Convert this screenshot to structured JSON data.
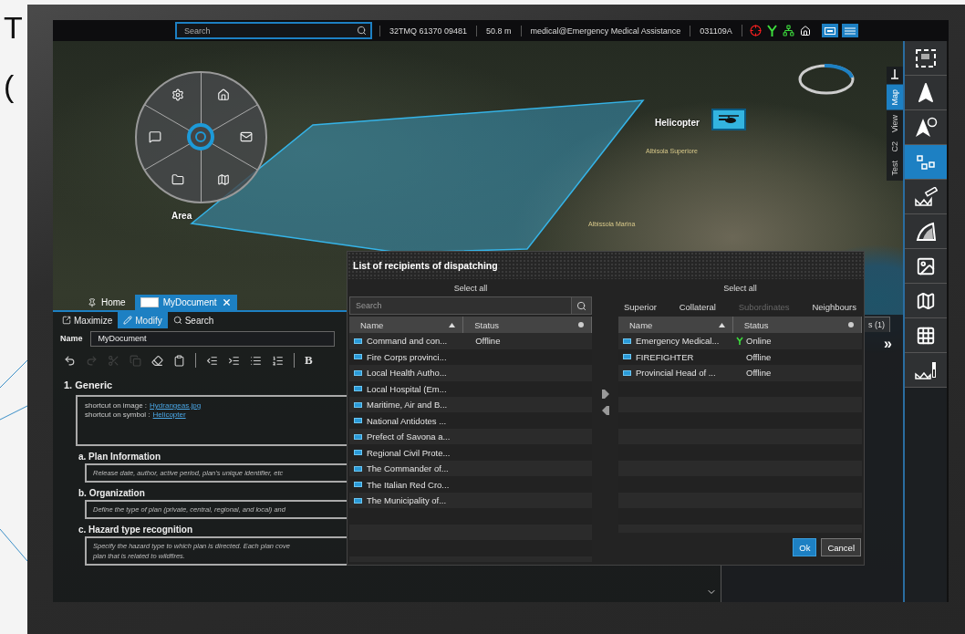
{
  "slide_fragments": [
    "T",
    "("
  ],
  "top_bar": {
    "search": {
      "placeholder": "Search"
    },
    "coordinates": "32TMQ 61370 09481",
    "altitude": "50.8 m",
    "user": "medical@Emergency Medical Assistance",
    "time": "031109A"
  },
  "map": {
    "labels": [
      {
        "text": "Area",
        "kind": "area"
      },
      {
        "text": "Helicopter",
        "kind": "unit"
      },
      {
        "text": "Albisola Superiore",
        "kind": "place"
      },
      {
        "text": "Albissola Marina",
        "kind": "place"
      }
    ]
  },
  "side_tabs": [
    {
      "label": "Map",
      "selected": true
    },
    {
      "label": "View",
      "selected": false
    },
    {
      "label": "C2",
      "selected": false
    },
    {
      "label": "Test",
      "selected": false
    }
  ],
  "toolbar": [
    {
      "kind": "select",
      "selected": false
    },
    {
      "kind": "navigate",
      "selected": false
    },
    {
      "kind": "navigate-compass",
      "selected": false
    },
    {
      "kind": "objects",
      "selected": true
    },
    {
      "kind": "measure",
      "selected": false
    },
    {
      "kind": "terrain",
      "selected": false
    },
    {
      "kind": "image",
      "selected": false
    },
    {
      "kind": "map",
      "selected": false
    },
    {
      "kind": "grid",
      "selected": false
    },
    {
      "kind": "elevation",
      "selected": false
    }
  ],
  "document": {
    "tabs": [
      {
        "label": "Home",
        "kind": "pin",
        "selected": false
      },
      {
        "label": "MyDocument",
        "kind": "document",
        "selected": true
      }
    ],
    "actions": [
      {
        "label": "Maximize",
        "kind": "maximize",
        "selected": false
      },
      {
        "label": "Modify",
        "kind": "modify",
        "selected": true
      },
      {
        "label": "Search",
        "kind": "search",
        "selected": false
      }
    ],
    "name_label": "Name",
    "name_value": "MyDocument",
    "editor_tools": [
      {
        "kind": "undo",
        "disabled": false
      },
      {
        "kind": "redo",
        "disabled": true
      },
      {
        "kind": "cut",
        "disabled": true
      },
      {
        "kind": "copy",
        "disabled": true
      },
      {
        "kind": "eraser",
        "disabled": false
      },
      {
        "kind": "paste",
        "disabled": false
      },
      {
        "kind": "separator"
      },
      {
        "kind": "outdent",
        "disabled": false
      },
      {
        "kind": "indent",
        "disabled": false
      },
      {
        "kind": "bullets",
        "disabled": false
      },
      {
        "kind": "numbers",
        "disabled": false
      },
      {
        "kind": "separator"
      }
    ],
    "bold_button": "B",
    "heading": "1. Generic",
    "shortcuts": [
      {
        "label": "shortcut on image :",
        "link": "Hydrangeas.jpg"
      },
      {
        "label": "shortcut on symbol :",
        "link": "Helicopter"
      }
    ],
    "sections": [
      {
        "title": "a. Plan Information",
        "lines": [
          "Release date, author, active period, plan's unique identifier, etc"
        ]
      },
      {
        "title": "b. Organization",
        "lines": [
          "Define the type of plan (private, central, regional, and local) and"
        ]
      },
      {
        "title": "c. Hazard type recognition",
        "lines": [
          "Specify the hazard type to which plan is directed. Each plan cove",
          "plan that is related to wildfires."
        ]
      }
    ]
  },
  "side_panel": {
    "tab": "s (1)",
    "expand": "»"
  },
  "dialog": {
    "title": "List of recipients of dispatching",
    "left": {
      "select_all": "Select all",
      "search": {
        "placeholder": "Search"
      },
      "columns": [
        {
          "label": "Name"
        },
        {
          "label": "Status"
        }
      ],
      "rows": [
        {
          "name": "Command and con...",
          "status": "Offline"
        },
        {
          "name": "Fire Corps provinci..."
        },
        {
          "name": "Local Health Autho..."
        },
        {
          "name": "Local Hospital (Em..."
        },
        {
          "name": "Maritime, Air and B..."
        },
        {
          "name": "National Antidotes ..."
        },
        {
          "name": "Prefect of Savona a..."
        },
        {
          "name": "Regional Civil Prote..."
        },
        {
          "name": "The Commander of..."
        },
        {
          "name": "The Italian Red Cro..."
        },
        {
          "name": "The Municipality of..."
        }
      ]
    },
    "right": {
      "select_all": "Select all",
      "filters": [
        {
          "label": "Superior",
          "disabled": false
        },
        {
          "label": "Collateral",
          "disabled": false
        },
        {
          "label": "Subordinates",
          "disabled": true
        },
        {
          "label": "Neighbours",
          "disabled": false
        }
      ],
      "columns": [
        {
          "label": "Name"
        },
        {
          "label": "Status"
        }
      ],
      "rows": [
        {
          "name": "Emergency Medical...",
          "status": "Online",
          "online": true
        },
        {
          "name": "FIREFIGHTER",
          "status": "Offline",
          "online": false
        },
        {
          "name": "Provincial Head of ...",
          "status": "Offline",
          "online": false
        }
      ]
    },
    "buttons": [
      {
        "label": "Ok",
        "kind": "primary"
      },
      {
        "label": "Cancel",
        "kind": "secondary"
      }
    ]
  }
}
